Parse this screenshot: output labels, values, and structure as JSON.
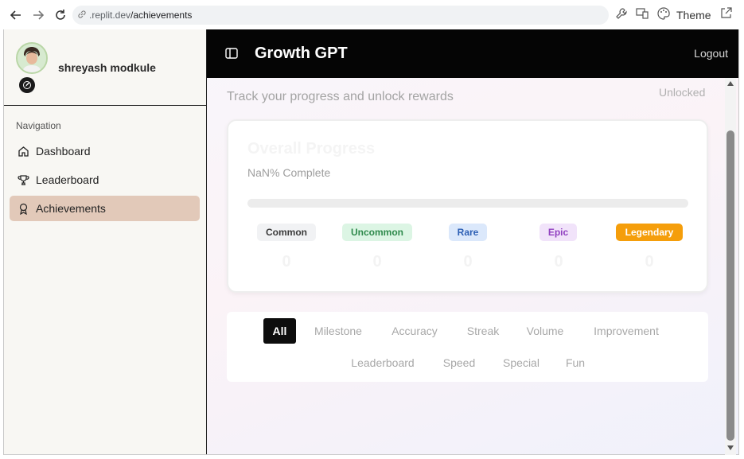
{
  "browser": {
    "url_host": ".replit.dev",
    "url_path": "/achievements",
    "theme_label": "Theme"
  },
  "sidebar": {
    "username": "shreyash modkule",
    "nav_heading": "Navigation",
    "items": [
      {
        "label": "Dashboard",
        "icon": "home-icon",
        "active": false
      },
      {
        "label": "Leaderboard",
        "icon": "trophy-icon",
        "active": false
      },
      {
        "label": "Achievements",
        "icon": "award-icon",
        "active": true
      }
    ]
  },
  "header": {
    "title": "Growth GPT",
    "logout_label": "Logout"
  },
  "main": {
    "subtitle": "Track your progress and unlock rewards",
    "unlocked_label": "Unlocked",
    "progress_card": {
      "title": "Overall Progress",
      "percent_text": "NaN% Complete",
      "progress_fraction": 0
    },
    "rarities": [
      {
        "label": "Common",
        "count": "0",
        "bg": "#f1f2f4",
        "fg": "#3a3a3a"
      },
      {
        "label": "Uncommon",
        "count": "0",
        "bg": "#dcf5e4",
        "fg": "#2f8a4c"
      },
      {
        "label": "Rare",
        "count": "0",
        "bg": "#dbe8fb",
        "fg": "#2d5fb4"
      },
      {
        "label": "Epic",
        "count": "0",
        "bg": "#f1e3fa",
        "fg": "#9040c0"
      },
      {
        "label": "Legendary",
        "count": "0",
        "bg": "#f59e0b",
        "fg": "#ffffff"
      }
    ],
    "filters": {
      "row1": [
        "All",
        "Milestone",
        "Accuracy",
        "Streak",
        "Volume",
        "Improvement"
      ],
      "row2": [
        "Leaderboard",
        "Speed",
        "Special",
        "Fun"
      ],
      "active": "All"
    }
  }
}
